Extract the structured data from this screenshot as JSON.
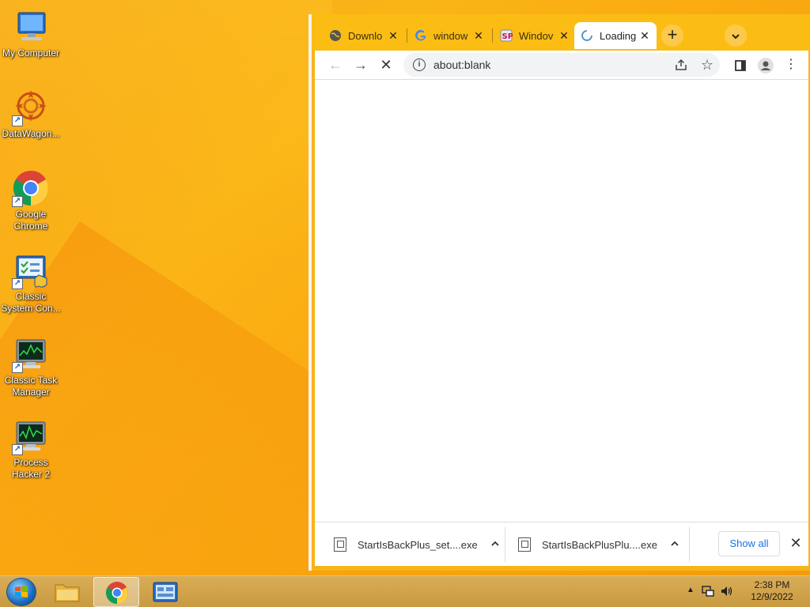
{
  "desktop": {
    "icons": [
      {
        "label": "My Computer"
      },
      {
        "label": "DataWagon..."
      },
      {
        "label": "Google Chrome"
      },
      {
        "label": "Classic System Con..."
      },
      {
        "label": "Classic Task Manager"
      },
      {
        "label": "Process Hacker 2"
      }
    ]
  },
  "browser": {
    "tabs": [
      {
        "title": "Downlo",
        "favicon": "globe-icon"
      },
      {
        "title": "window",
        "favicon": "google-icon"
      },
      {
        "title": "Windov",
        "favicon": "site-icon"
      },
      {
        "title": "Loading",
        "favicon": "loading-spinner-icon",
        "active": true
      }
    ],
    "new_tab_label": "+",
    "address": "about:blank",
    "downloads": [
      {
        "filename": "StartIsBackPlus_set....exe"
      },
      {
        "filename": "StartIsBackPlusPlu....exe"
      }
    ],
    "show_all_label": "Show all"
  },
  "taskbar": {
    "time": "2:38 PM",
    "date": "12/9/2022"
  },
  "colors": {
    "accent": "#1a73e8",
    "tabstrip": "#fbbd14",
    "wallpaper": "#f9a90f"
  }
}
